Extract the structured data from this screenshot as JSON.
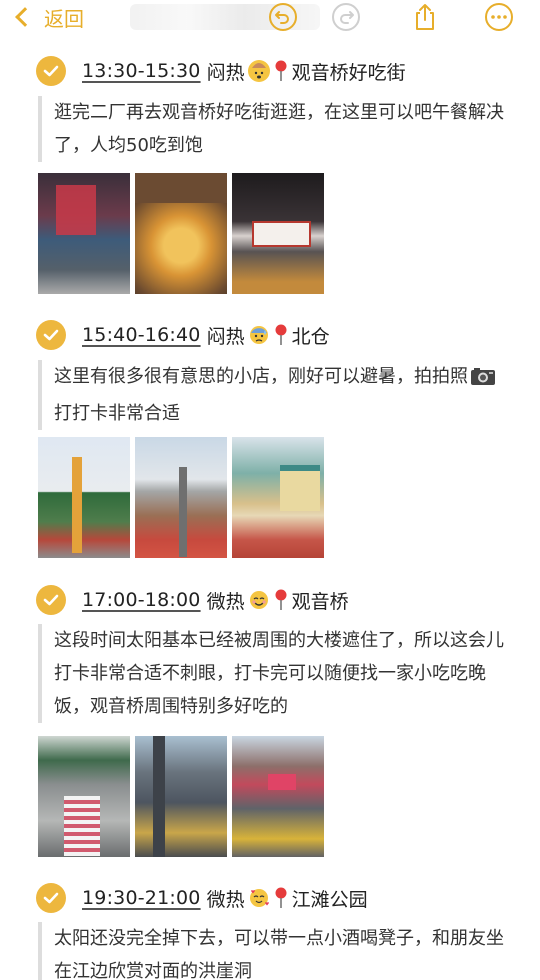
{
  "topbar": {
    "back_label": "返回",
    "tools": [
      "undo-icon",
      "redo-icon",
      "share-icon",
      "more-icon"
    ]
  },
  "colors": {
    "accent": "#E7AE2B",
    "check": "#EDB73E"
  },
  "sections": [
    {
      "time": "13:30-15:30",
      "weather": "闷热",
      "emoji": "exploding-head-emoji",
      "place": "观音桥好吃街",
      "text": "逛完二厂再去观音桥好吃街逛逛，在这里可以吧午餐解决了，人均50吃到饱",
      "photos": [
        "photo-street-signs",
        "photo-takoyaki",
        "photo-market-hall"
      ]
    },
    {
      "time": "15:40-16:40",
      "weather": "闷热",
      "emoji": "anxious-sweat-emoji",
      "place": "北仓",
      "text": "这里有很多很有意思的小店，刚好可以避暑，拍拍照",
      "text_tail": "打打卡非常合适",
      "inline_icon": "camera-emoji",
      "photos": [
        "photo-tower-gate",
        "photo-red-street",
        "photo-yellow-house"
      ]
    },
    {
      "time": "17:00-18:00",
      "weather": "微热",
      "emoji": "smiling-face-emoji",
      "place": "观音桥",
      "text": "这段时间太阳基本已经被周围的大楼遮住了，所以这会儿打卡非常合适不刺眼，打卡完可以随便找一家小吃吃晚饭，观音桥周围特别多好吃的",
      "photos": [
        "photo-crosswalk",
        "photo-traffic",
        "photo-taxis"
      ]
    },
    {
      "time": "19:30-21:00",
      "weather": "微热",
      "emoji": "hearts-face-emoji",
      "place": "江滩公园",
      "text": "太阳还没完全掉下去，可以带一点小酒喝凳子，和朋友坐在江边欣赏对面的洪崖洞"
    }
  ]
}
